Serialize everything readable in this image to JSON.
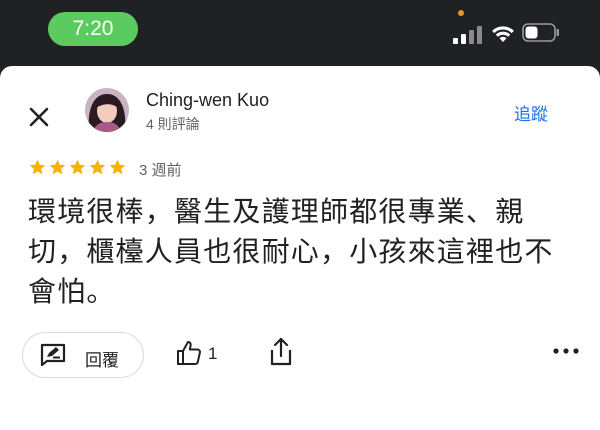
{
  "status_bar": {
    "time": "7:20",
    "icons": [
      "signal-icon",
      "wifi-icon",
      "battery-icon"
    ],
    "time_pill_color": "#5ccb5f",
    "mic_indicator_color": "#f0932b"
  },
  "review": {
    "author": "Ching-wen Kuo",
    "review_count": "4 則評論",
    "follow_label": "追蹤",
    "rating": 5,
    "rating_max": 5,
    "relative_time": "3 週前",
    "text": "環境很棒，醫生及護理師都很專業、親切，櫃檯人員也很耐心，小孩來這裡也不會怕。",
    "icons": [
      "close-icon",
      "star-icon",
      "reply-icon",
      "thumbs-up-icon",
      "share-icon",
      "more-icon"
    ]
  },
  "actions": {
    "reply_label": "回覆",
    "like_count": "1"
  },
  "colors": {
    "accent": "#1a73e8",
    "star": "#f4b400",
    "background_dark": "#202124"
  }
}
